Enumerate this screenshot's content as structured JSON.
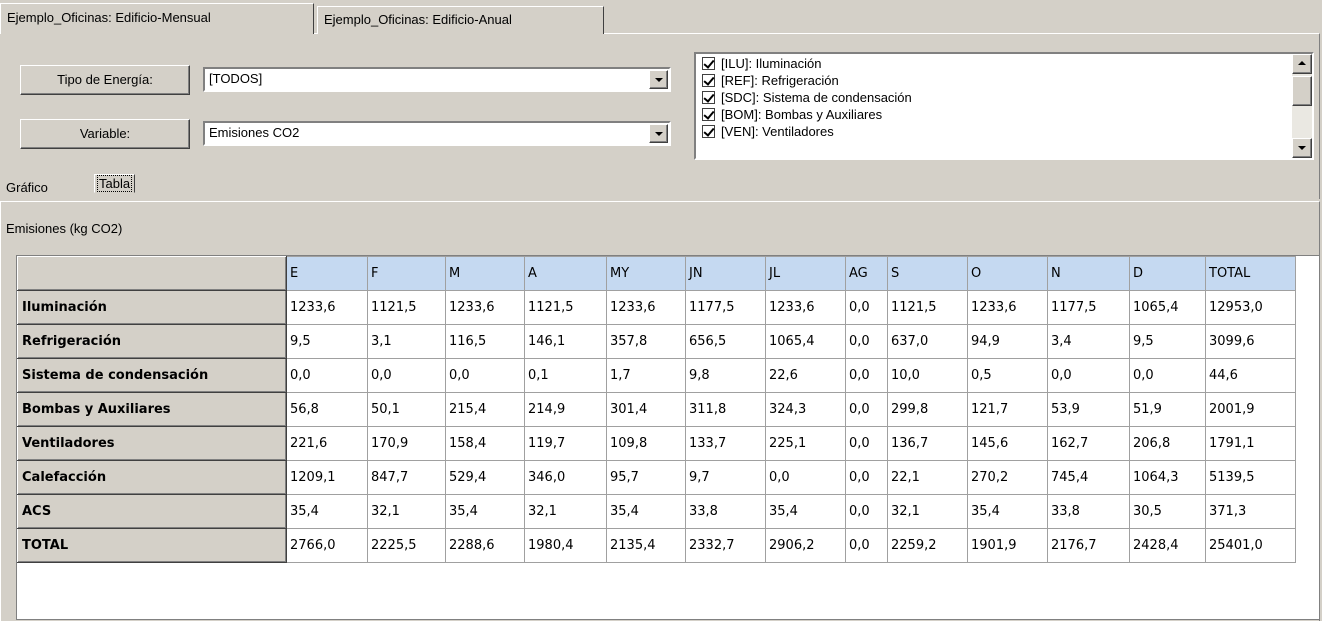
{
  "top_tabs": [
    {
      "label": "Ejemplo_Oficinas: Edificio-Mensual",
      "active": true
    },
    {
      "label": "Ejemplo_Oficinas: Edificio-Anual",
      "active": false
    }
  ],
  "filters": {
    "energy_type_label": "Tipo de Energía:",
    "energy_type_value": "[TODOS]",
    "variable_label": "Variable:",
    "variable_value": "Emisiones CO2"
  },
  "checklist": [
    {
      "label": "[ILU]: Iluminación",
      "checked": true
    },
    {
      "label": "[REF]: Refrigeración",
      "checked": true
    },
    {
      "label": "[SDC]: Sistema de condensación",
      "checked": true
    },
    {
      "label": "[BOM]: Bombas y Auxiliares",
      "checked": true
    },
    {
      "label": "[VEN]: Ventiladores",
      "checked": true
    }
  ],
  "view_tabs": [
    {
      "label": "Gráfico",
      "active": false
    },
    {
      "label": "Tabla",
      "active": true
    }
  ],
  "table_title": "Emisiones (kg CO2)",
  "table": {
    "columns": [
      "E",
      "F",
      "M",
      "A",
      "MY",
      "JN",
      "JL",
      "AG",
      "S",
      "O",
      "N",
      "D",
      "TOTAL"
    ],
    "rows": [
      {
        "label": "Iluminación",
        "values": [
          "1233,6",
          "1121,5",
          "1233,6",
          "1121,5",
          "1233,6",
          "1177,5",
          "1233,6",
          "0,0",
          "1121,5",
          "1233,6",
          "1177,5",
          "1065,4",
          "12953,0"
        ]
      },
      {
        "label": "Refrigeración",
        "values": [
          "9,5",
          "3,1",
          "116,5",
          "146,1",
          "357,8",
          "656,5",
          "1065,4",
          "0,0",
          "637,0",
          "94,9",
          "3,4",
          "9,5",
          "3099,6"
        ]
      },
      {
        "label": "Sistema de condensación",
        "values": [
          "0,0",
          "0,0",
          "0,0",
          "0,1",
          "1,7",
          "9,8",
          "22,6",
          "0,0",
          "10,0",
          "0,5",
          "0,0",
          "0,0",
          "44,6"
        ]
      },
      {
        "label": "Bombas y Auxiliares",
        "values": [
          "56,8",
          "50,1",
          "215,4",
          "214,9",
          "301,4",
          "311,8",
          "324,3",
          "0,0",
          "299,8",
          "121,7",
          "53,9",
          "51,9",
          "2001,9"
        ]
      },
      {
        "label": "Ventiladores",
        "values": [
          "221,6",
          "170,9",
          "158,4",
          "119,7",
          "109,8",
          "133,7",
          "225,1",
          "0,0",
          "136,7",
          "145,6",
          "162,7",
          "206,8",
          "1791,1"
        ]
      },
      {
        "label": "Calefacción",
        "values": [
          "1209,1",
          "847,7",
          "529,4",
          "346,0",
          "95,7",
          "9,7",
          "0,0",
          "0,0",
          "22,1",
          "270,2",
          "745,4",
          "1064,3",
          "5139,5"
        ]
      },
      {
        "label": "ACS",
        "values": [
          "35,4",
          "32,1",
          "35,4",
          "32,1",
          "35,4",
          "33,8",
          "35,4",
          "0,0",
          "32,1",
          "35,4",
          "33,8",
          "30,5",
          "371,3"
        ]
      },
      {
        "label": "TOTAL",
        "values": [
          "2766,0",
          "2225,5",
          "2288,6",
          "1980,4",
          "2135,4",
          "2332,7",
          "2906,2",
          "0,0",
          "2259,2",
          "1901,9",
          "2176,7",
          "2428,4",
          "25401,0"
        ]
      }
    ]
  },
  "colors": {
    "window_bg": "#d4d0c8",
    "column_header_bg": "#c5d9f1",
    "grid_bg": "#ffffff"
  }
}
